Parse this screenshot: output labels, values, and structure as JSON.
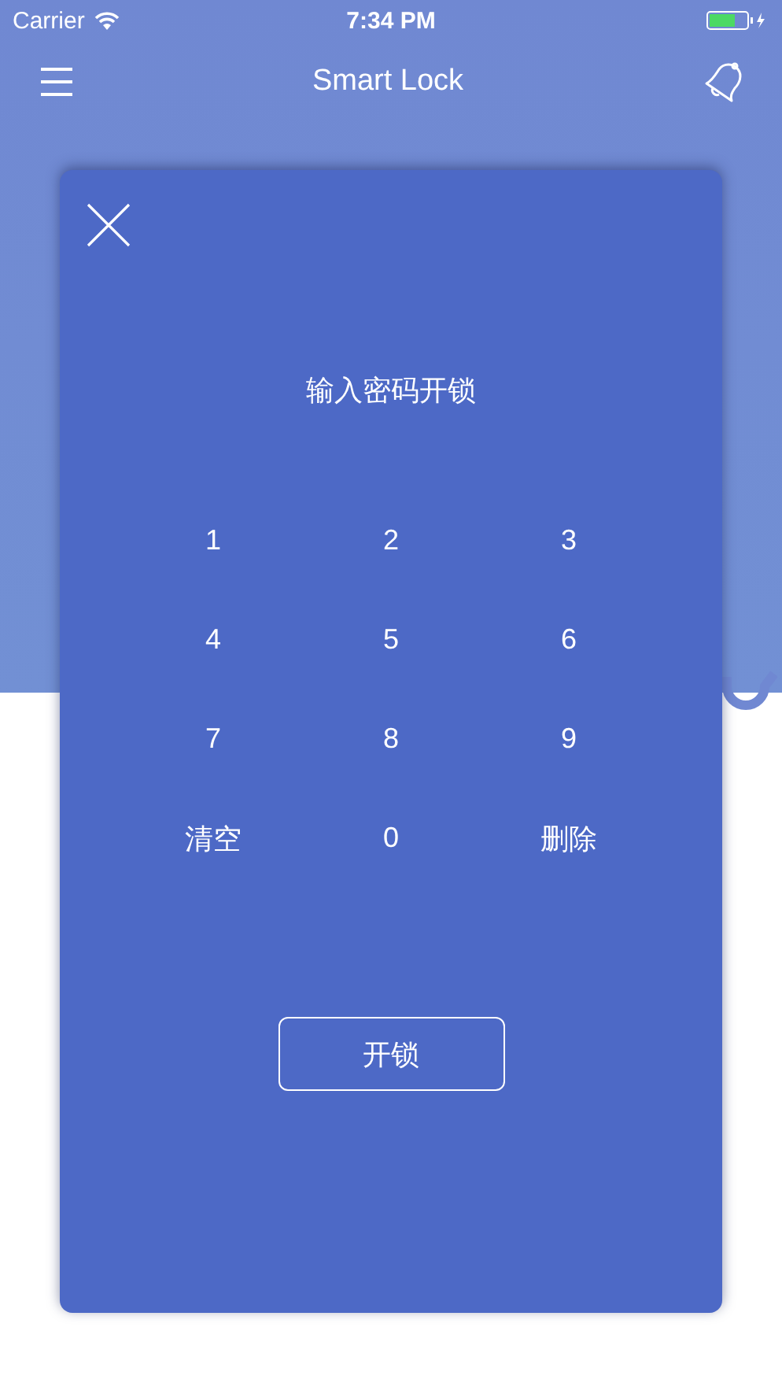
{
  "status_bar": {
    "carrier": "Carrier",
    "time": "7:34 PM"
  },
  "nav": {
    "title": "Smart Lock"
  },
  "dialog": {
    "prompt": "输入密码开锁",
    "keys": [
      "1",
      "2",
      "3",
      "4",
      "5",
      "6",
      "7",
      "8",
      "9",
      "清空",
      "0",
      "删除"
    ],
    "button": "开锁"
  }
}
